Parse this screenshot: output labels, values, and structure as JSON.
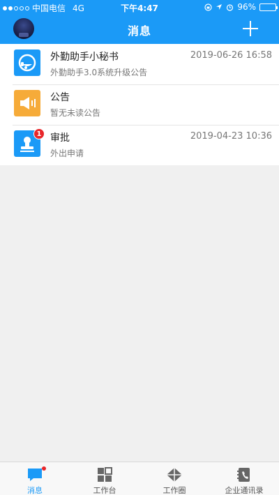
{
  "statusbar": {
    "carrier": "中国电信",
    "network": "4G",
    "time": "下午4:47",
    "battery": "96%",
    "battery_level": 0.96
  },
  "header": {
    "title": "消息"
  },
  "messages": [
    {
      "name": "外勤助手小秘书",
      "time": "2019-06-26 16:58",
      "preview": "外勤助手3.0系统升级公告",
      "icon": "headset-icon",
      "color": "#1b9af7"
    },
    {
      "name": "公告",
      "time": "",
      "preview": "暂无未读公告",
      "icon": "megaphone-icon",
      "color": "#f6ab39"
    },
    {
      "name": "审批",
      "time": "2019-04-23 10:36",
      "preview": "外出申请",
      "icon": "stamp-icon",
      "color": "#1b9af7",
      "badge": "1"
    }
  ],
  "tabs": [
    {
      "label": "消息",
      "icon": "chat-icon",
      "active": true
    },
    {
      "label": "工作台",
      "icon": "grid-icon"
    },
    {
      "label": "工作圈",
      "icon": "diamond-icon"
    },
    {
      "label": "企业通讯录",
      "icon": "contacts-icon"
    }
  ],
  "colors": {
    "accent": "#1b9af7",
    "orange": "#f6ab39",
    "badge": "#e8262a"
  }
}
